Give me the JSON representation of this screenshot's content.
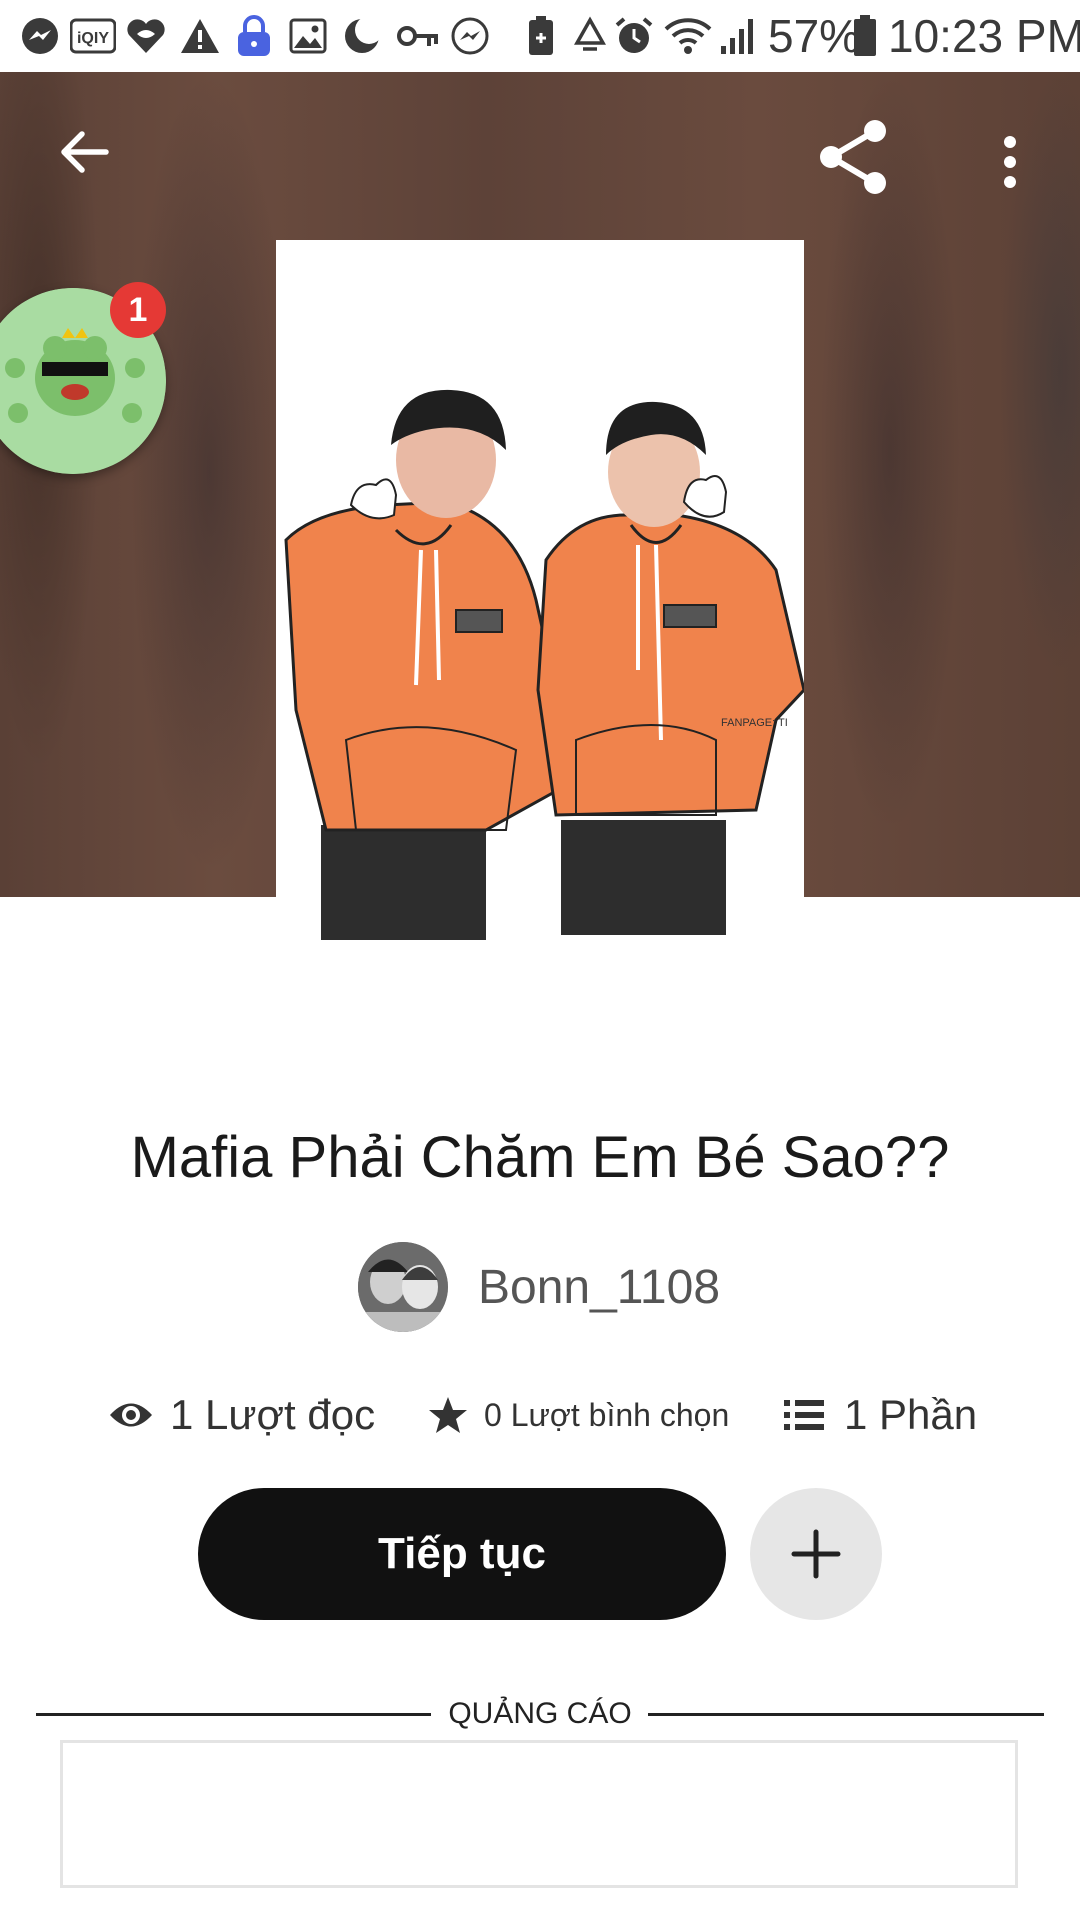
{
  "status_bar": {
    "battery": "57%",
    "time": "10:23 PM",
    "icons": [
      "messenger-icon",
      "iqiyi-icon",
      "heart-app-icon",
      "warning-icon",
      "lock-app-icon",
      "image-icon",
      "moon-icon",
      "key-icon",
      "messenger-icon",
      "battery-saver-icon",
      "recycle-icon",
      "alarm-icon",
      "wifi-icon",
      "signal-icon",
      "battery-icon"
    ]
  },
  "toolbar": {
    "back_icon": "back-arrow-icon",
    "share_icon": "share-icon",
    "more_icon": "more-vertical-icon"
  },
  "chat_bubble": {
    "badge_count": "1"
  },
  "story": {
    "title": "Mafia Phải Chăm Em Bé Sao??",
    "author": "Bonn_1108",
    "reads": "1 Lượt đọc",
    "votes": "0 Lượt bình chọn",
    "parts": "1 Phần"
  },
  "actions": {
    "continue_label": "Tiếp tục",
    "add_icon": "plus-icon"
  },
  "ad": {
    "label": "QUẢNG CÁO"
  },
  "colors": {
    "hero_bg": "#62463a",
    "hoodie": "#f0834c",
    "button_dark": "#111111",
    "badge": "#e53935"
  }
}
